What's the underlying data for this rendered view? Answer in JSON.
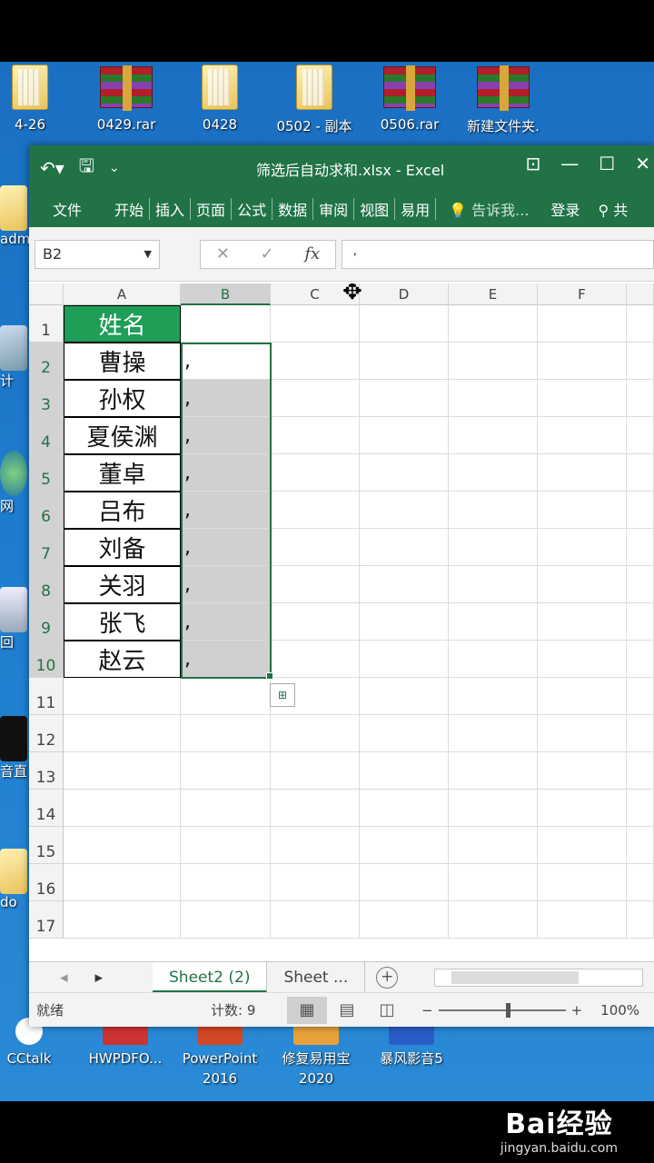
{
  "desktop": {
    "top_icons": [
      {
        "label": "4-26",
        "kind": "folder"
      },
      {
        "label": "0429.rar",
        "kind": "rar"
      },
      {
        "label": "0428",
        "kind": "folder"
      },
      {
        "label": "0502 - 副本",
        "kind": "folder"
      },
      {
        "label": "0506.rar",
        "kind": "rar"
      },
      {
        "label": "新建文件夹.",
        "kind": "rar"
      }
    ],
    "left_icons": [
      {
        "label": "admi"
      },
      {
        "label": "计"
      },
      {
        "label": "网"
      },
      {
        "label": "回"
      },
      {
        "label": "音直"
      },
      {
        "label": "do"
      }
    ],
    "bottom_icons": [
      {
        "label": "CCtalk"
      },
      {
        "label": "HWPDFO..."
      },
      {
        "label": "PowerPoint 2016"
      },
      {
        "label": "修复易用宝 2020"
      },
      {
        "label": "暴风影音5"
      }
    ]
  },
  "excel": {
    "title": "筛选后自动求和.xlsx - Excel",
    "ribbon_tabs": [
      "文件",
      "开始",
      "插入",
      "页面",
      "公式",
      "数据",
      "审阅",
      "视图",
      "易用"
    ],
    "tell_me": "告诉我...",
    "login": "登录",
    "share": "共",
    "name_box": "B2",
    "formula_fx": "fx",
    "formula_value": ",",
    "columns": [
      "A",
      "B",
      "C",
      "D",
      "E",
      "F"
    ],
    "rows": [
      "1",
      "2",
      "3",
      "4",
      "5",
      "6",
      "7",
      "8",
      "9",
      "10",
      "11",
      "12",
      "13",
      "14",
      "15",
      "16",
      "17"
    ],
    "cells_A": [
      "姓名",
      "曹操",
      "孙权",
      "夏侯渊",
      "董卓",
      "吕布",
      "刘备",
      "关羽",
      "张飞",
      "赵云"
    ],
    "cells_B": [
      "",
      ",",
      ",",
      ",",
      ",",
      ",",
      ",",
      ",",
      ",",
      ","
    ],
    "sheet_tabs": [
      "Sheet2 (2)",
      "Sheet ..."
    ],
    "status_ready": "就绪",
    "status_count": "计数: 9",
    "zoom": "100%"
  },
  "watermark": {
    "logo": "Bai经验",
    "url": "jingyan.baidu.com"
  }
}
